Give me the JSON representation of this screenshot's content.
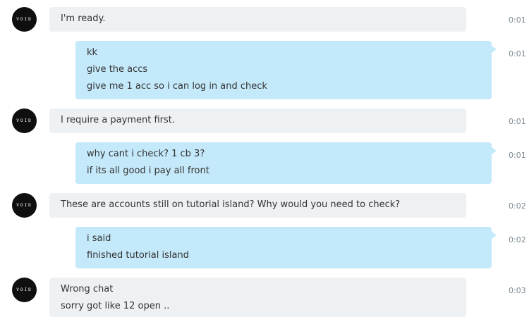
{
  "messages": [
    {
      "direction": "incoming",
      "avatar_label": "VOID",
      "lines": [
        "I'm ready."
      ],
      "time": "0:01"
    },
    {
      "direction": "outgoing",
      "lines": [
        "kk",
        "give the accs",
        "give me 1 acc so i can log in and check"
      ],
      "time": "0:01"
    },
    {
      "direction": "incoming",
      "avatar_label": "VOID",
      "lines": [
        "I require a payment first."
      ],
      "time": "0:01"
    },
    {
      "direction": "outgoing",
      "lines": [
        "why cant i check? 1 cb 3?",
        "if its all good i pay all front"
      ],
      "time": "0:01"
    },
    {
      "direction": "incoming",
      "avatar_label": "VOID",
      "lines": [
        "These are accounts still on tutorial island? Why would you need to check?"
      ],
      "time": "0:02"
    },
    {
      "direction": "outgoing",
      "lines": [
        "i said",
        "finished tutorial island"
      ],
      "time": "0:02"
    },
    {
      "direction": "incoming",
      "avatar_label": "VOID",
      "lines": [
        "Wrong chat",
        "sorry got like 12 open .."
      ],
      "time": "0:03"
    }
  ]
}
